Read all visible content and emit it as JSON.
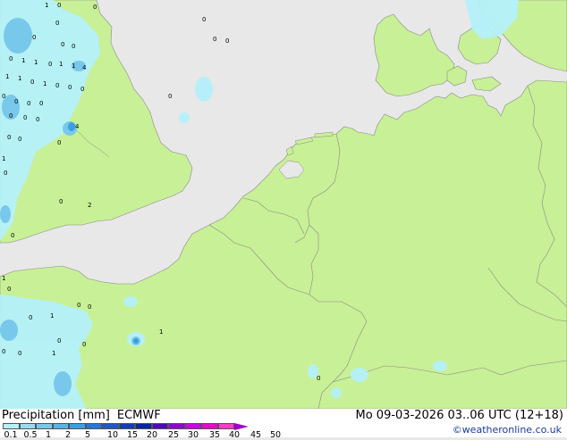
{
  "footer": {
    "title": "Precipitation [mm]",
    "model": "ECMWF",
    "datetime": "Mo 09-03-2026 03..06 UTC (12+18)",
    "credit": "©weatheronline.co.uk"
  },
  "legend": {
    "ticks": [
      "0.1",
      "0.5",
      "1",
      "2",
      "5",
      "10",
      "15",
      "20",
      "25",
      "30",
      "35",
      "40",
      "45",
      "50"
    ],
    "colors": [
      "#b4f0fa",
      "#96dcf0",
      "#78c8eb",
      "#5ab4e6",
      "#3c9ee0",
      "#2878d2",
      "#1e5abe",
      "#1440aa",
      "#0a2896",
      "#500ab4",
      "#8c0ac8",
      "#c80adc",
      "#e60ac8",
      "#ff3cc8"
    ]
  },
  "map": {
    "colors": {
      "sea": "#e8e8e8",
      "land": "#c8f096",
      "border": "#8a8a8a",
      "precip_light": "#b4f0fa",
      "precip_mid": "#78c8eb",
      "precip_heavy": "#3c9ee0"
    },
    "labels": [
      "1",
      "0",
      "0",
      "0",
      "0",
      "0",
      "0",
      "0",
      "1",
      "1",
      "0",
      "1",
      "1",
      "4",
      "1",
      "1",
      "0",
      "1",
      "0",
      "0",
      "0",
      "0",
      "0",
      "0",
      "0",
      "4",
      "0",
      "0",
      "0",
      "0",
      "0",
      "0",
      "0",
      "0",
      "0",
      "0",
      "2",
      "1",
      "0",
      "0",
      "0",
      "1",
      "0",
      "0",
      "1",
      "0",
      "0",
      "1",
      "0",
      "0",
      "0",
      "0",
      "1",
      "0"
    ]
  }
}
